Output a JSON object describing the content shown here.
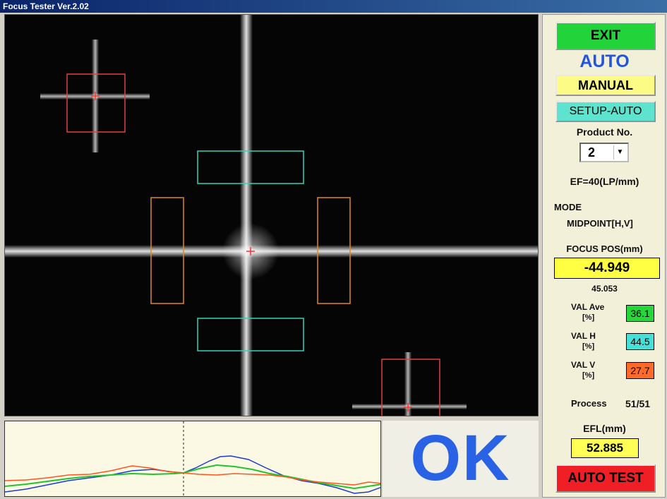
{
  "window": {
    "title": "Focus Tester  Ver.2.02"
  },
  "side": {
    "exit_label": "EXIT",
    "mode_status": "AUTO",
    "manual_label": "MANUAL",
    "setup_label": "SETUP-AUTO",
    "product_label": "Product No.",
    "product_value": "2",
    "ef_label": "EF=40(LP/mm)",
    "mode_label": "MODE",
    "mode_value": "MIDPOINT[H,V]",
    "focus_label": "FOCUS  POS(mm)",
    "focus_value": "-44.949",
    "focus_sub": "45.053",
    "val_ave_label": "VAL Ave",
    "val_ave_unit": "[%]",
    "val_ave_value": "36.1",
    "val_h_label": "VAL H",
    "val_h_unit": "[%]",
    "val_h_value": "44.5",
    "val_v_label": "VAL V",
    "val_v_unit": "[%]",
    "val_v_value": "27.7",
    "process_label": "Process",
    "process_value": "51/51",
    "efl_label": "EFL(mm)",
    "efl_value": "52.885",
    "auto_test_label": "AUTO TEST"
  },
  "result": {
    "text": "OK"
  },
  "colors": {
    "exit": "#22d43a",
    "auto": "#2255dd",
    "manual": "#fbfb85",
    "setup": "#5ee3cf",
    "focus_box": "#ffff44",
    "val_ave": "#27d63a",
    "val_h": "#45e0d8",
    "val_v": "#ff6a2a",
    "efl_box": "#ffff55",
    "auto_test": "#ef1f25",
    "ok": "#2a62e6"
  }
}
